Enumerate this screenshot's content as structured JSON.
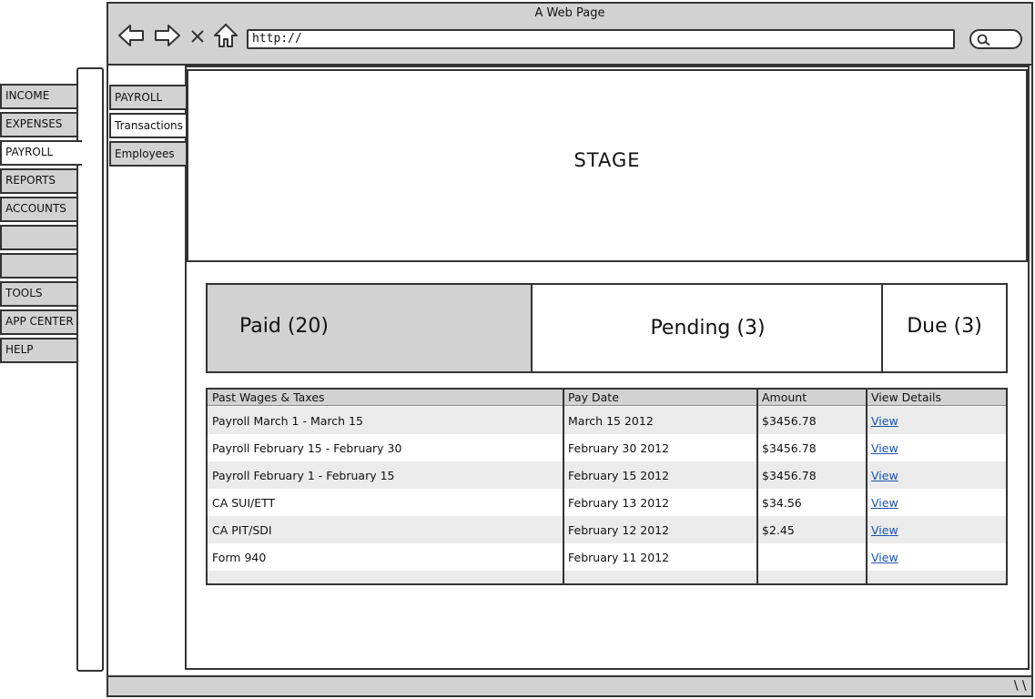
{
  "window": {
    "title": "A Web Page",
    "url": "http://"
  },
  "outer_nav": {
    "items": [
      {
        "label": "INCOME",
        "active": false
      },
      {
        "label": "EXPENSES",
        "active": false
      },
      {
        "label": "PAYROLL",
        "active": true
      },
      {
        "label": "REPORTS",
        "active": false
      },
      {
        "label": "ACCOUNTS",
        "active": false
      },
      {
        "label": "",
        "active": false
      },
      {
        "label": "",
        "active": false
      },
      {
        "label": "TOOLS",
        "active": false
      },
      {
        "label": "APP CENTER",
        "active": false
      },
      {
        "label": "HELP",
        "active": false
      }
    ]
  },
  "sub_nav": {
    "items": [
      {
        "label": "PAYROLL",
        "active": false
      },
      {
        "label": "Transactions",
        "active": true
      },
      {
        "label": "Employees",
        "active": false
      }
    ]
  },
  "stage": {
    "label": "STAGE"
  },
  "tabs": {
    "paid": "Paid (20)",
    "pending": "Pending (3)",
    "due": "Due (3)"
  },
  "table": {
    "headers": [
      "Past Wages & Taxes",
      "Pay Date",
      "Amount",
      "View Details"
    ],
    "rows": [
      [
        "Payroll March 1 - March 15",
        "March 15 2012",
        "$3456.78",
        "View"
      ],
      [
        "Payroll February 15 - February 30",
        "February 30 2012",
        "$3456.78",
        "View"
      ],
      [
        "Payroll February 1 - February 15",
        "February 15 2012",
        "$3456.78",
        "View"
      ],
      [
        "CA SUI/ETT",
        "February 13 2012",
        "$34.56",
        "View"
      ],
      [
        "CA PIT/SDI",
        "February 12 2012",
        "$2.45",
        "View"
      ],
      [
        "Form 940",
        "February 11 2012",
        "",
        "View"
      ]
    ]
  },
  "icons": {
    "back": "back-arrow-icon",
    "forward": "forward-arrow-icon",
    "stop": "close-icon",
    "home": "home-icon",
    "search": "search-icon",
    "resize": "resize-grip-icon"
  },
  "colors": {
    "chrome": "#d2d2d2",
    "link": "#1a55a8",
    "row_alt": "#ebebeb",
    "outline": "#333333"
  }
}
